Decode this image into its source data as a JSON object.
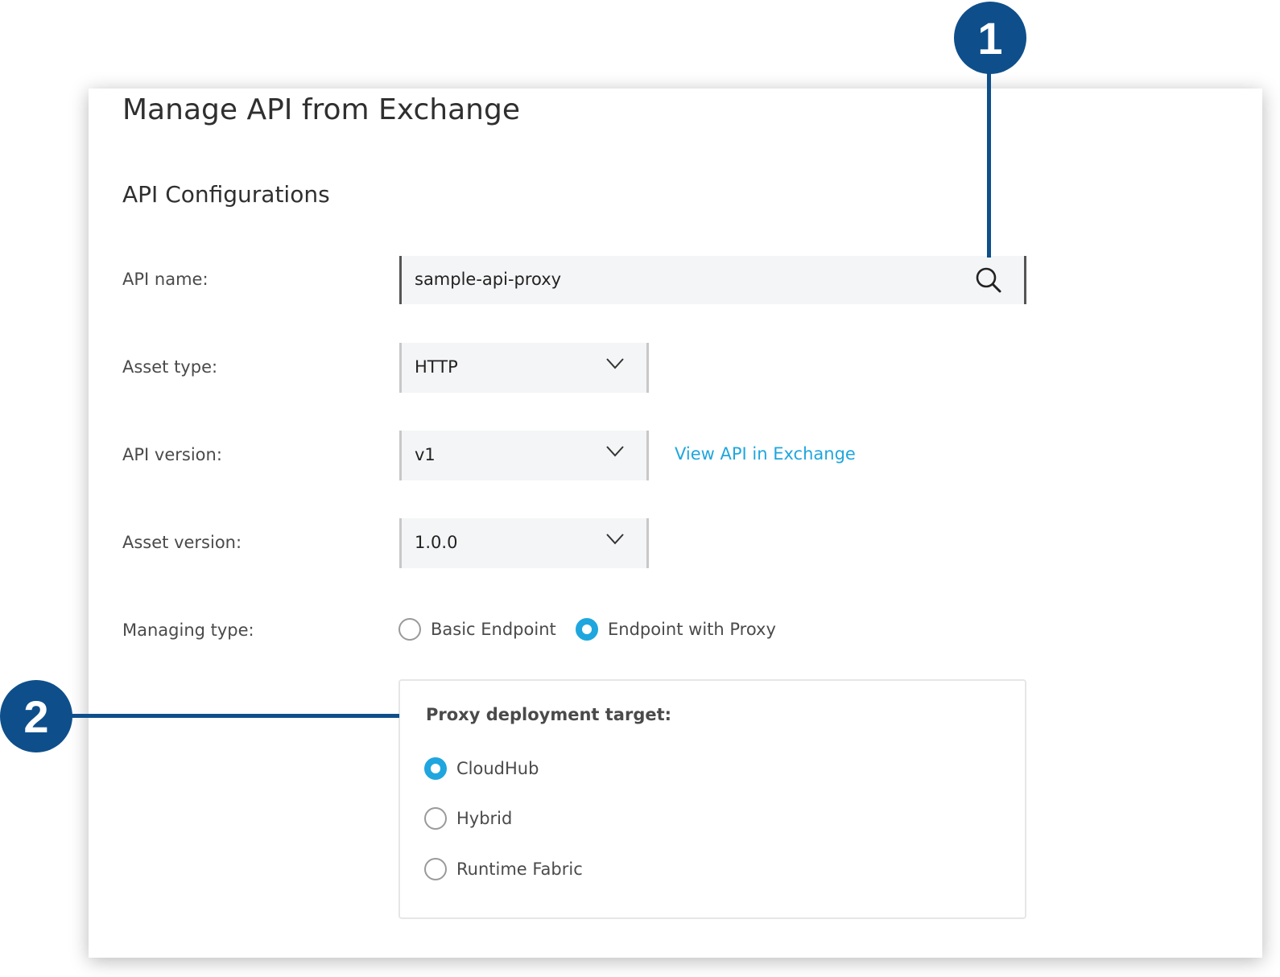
{
  "page": {
    "title": "Manage API from Exchange",
    "section_title": "API Configurations"
  },
  "api_name": {
    "label": "API name:",
    "value": "sample-api-proxy",
    "icon": "search-icon"
  },
  "asset_type": {
    "label": "Asset type:",
    "value": "HTTP"
  },
  "api_version": {
    "label": "API version:",
    "value": "v1",
    "link_label": "View API in Exchange"
  },
  "asset_version": {
    "label": "Asset version:",
    "value": "1.0.0"
  },
  "managing_type": {
    "label": "Managing type:",
    "options": [
      {
        "label": "Basic Endpoint",
        "checked": false
      },
      {
        "label": "Endpoint with Proxy",
        "checked": true
      }
    ]
  },
  "proxy_target": {
    "title": "Proxy deployment target:",
    "options": [
      {
        "label": "CloudHub",
        "checked": true
      },
      {
        "label": "Hybrid",
        "checked": false
      },
      {
        "label": "Runtime Fabric",
        "checked": false
      }
    ]
  },
  "callouts": [
    "1",
    "2"
  ],
  "colors": {
    "accent": "#1fa6de",
    "callout": "#0e4f8b",
    "input_bg": "#f4f5f6"
  }
}
